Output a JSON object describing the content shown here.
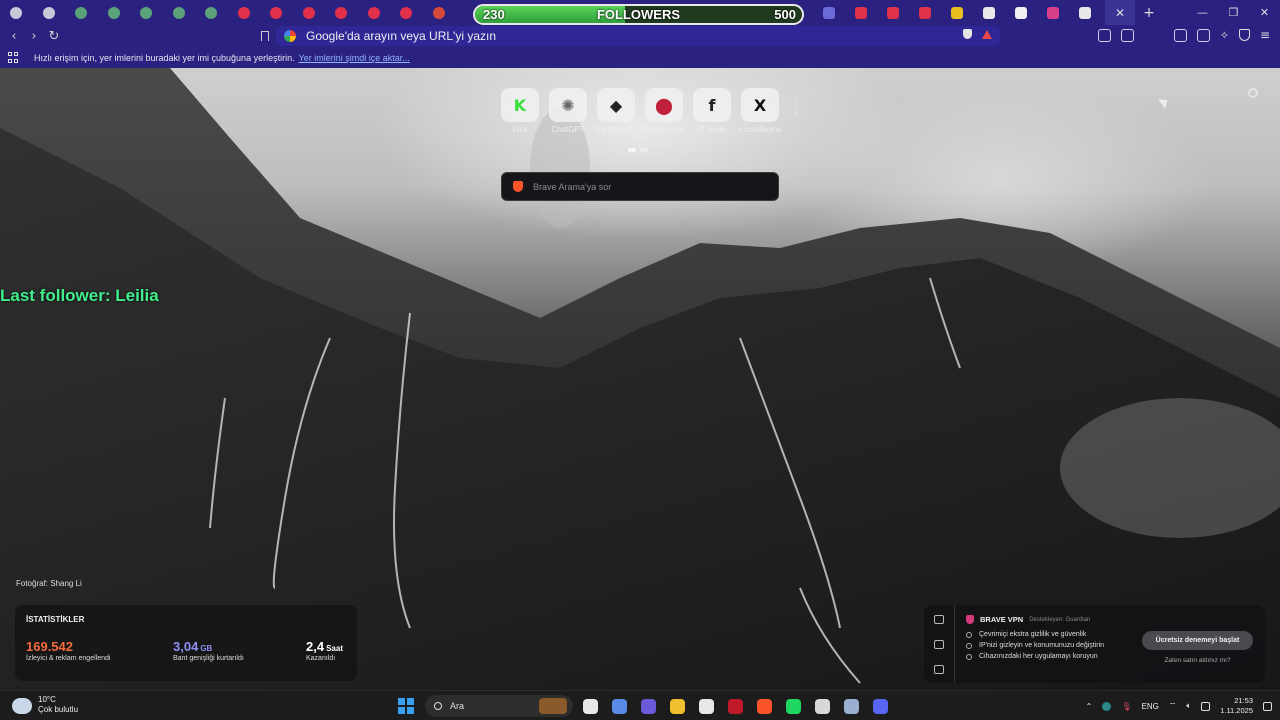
{
  "tabs": {
    "favicons": [
      {
        "name": "obs-icon",
        "color": "#c8c8d8"
      },
      {
        "name": "chat-icon",
        "color": "#c8c8d8"
      },
      {
        "name": "tab-app-icon",
        "color": "#5aa37a"
      },
      {
        "name": "tab-app-icon",
        "color": "#5aa37a"
      },
      {
        "name": "tab-app-icon",
        "color": "#5aa37a"
      },
      {
        "name": "tab-app-icon",
        "color": "#5aa37a"
      },
      {
        "name": "tab-app-icon",
        "color": "#5aa37a"
      },
      {
        "name": "youtube-icon",
        "color": "#e0304a"
      },
      {
        "name": "youtube-icon",
        "color": "#e0304a"
      },
      {
        "name": "youtube-icon",
        "color": "#e0304a"
      },
      {
        "name": "youtube-icon",
        "color": "#e0304a"
      },
      {
        "name": "youtube-icon",
        "color": "#e0304a"
      },
      {
        "name": "youtube-icon",
        "color": "#e0304a"
      },
      {
        "name": "gmail-icon",
        "color": "#d84a3a"
      }
    ],
    "right_favicons": [
      {
        "name": "site-icon",
        "color": "#6a6ad8"
      },
      {
        "name": "youtube-icon",
        "color": "#e0304a"
      },
      {
        "name": "youtube-icon",
        "color": "#e0304a"
      },
      {
        "name": "youtube-icon",
        "color": "#e0304a"
      },
      {
        "name": "notes-icon",
        "color": "#e8c020"
      },
      {
        "name": "apps-icon",
        "color": "#e8e8e8"
      },
      {
        "name": "site-icon",
        "color": "#f0f0f0"
      },
      {
        "name": "instagram-icon",
        "color": "#d8408a"
      },
      {
        "name": "chatgpt-icon",
        "color": "#e8e8e8"
      }
    ]
  },
  "followers_goal": {
    "current": "230",
    "label": "FOLLOWERS",
    "goal": "500",
    "progress": 0.46
  },
  "omnibox": {
    "placeholder": "Google'da arayın veya URL'yi yazın"
  },
  "bookmarks": {
    "hint": "Hızlı erişim için, yer imlerini buradaki yer imi çubuğuna yerleştirin.",
    "import_link": "Yer imlerini şimdi içe aktar..."
  },
  "top_sites": [
    {
      "name": "Kick",
      "icon": "kick-icon",
      "glyph": "K",
      "color": "#3ae03a"
    },
    {
      "name": "ChatGPT",
      "icon": "chatgpt-icon",
      "glyph": "✺",
      "color": "#6a6a6a"
    },
    {
      "name": "The Best C...",
      "icon": "discord-icon",
      "glyph": "◆",
      "color": "#222"
    },
    {
      "name": "GeoGuessr",
      "icon": "map-pin-icon",
      "glyph": "⬤",
      "color": "#c0203a"
    },
    {
      "name": "f2 Node",
      "icon": "f-icon",
      "glyph": "f",
      "color": "#222"
    },
    {
      "name": "x.com/home",
      "icon": "x-icon",
      "glyph": "X",
      "color": "#111"
    }
  ],
  "search": {
    "placeholder": "Brave Arama'ya sor"
  },
  "overlay": {
    "last_follower": "Last follower: Leilia"
  },
  "photo_credit": "Fotoğraf: Shang Li",
  "stats": {
    "title": "İSTATİSTİKLER",
    "items": [
      {
        "value": "169.542",
        "unit": "",
        "desc": "İzleyici & reklam engellendi",
        "color": "#f26b3a"
      },
      {
        "value": "3,04",
        "unit": "GB",
        "desc": "Bant genişliği kurtarıldı",
        "color": "#8f8ff5"
      },
      {
        "value": "2,4",
        "unit": "Saat",
        "desc": "Kazanıldı",
        "color": "#ffffff"
      }
    ]
  },
  "vpn": {
    "title": "BRAVE VPN",
    "by": "Destekleyen: Guardian",
    "features": [
      "Çevrimiçi ekstra gizlilik ve güvenlik",
      "IP'nizi gizleyin ve konumunuzu değiştirin",
      "Cihazınızdaki her uygulamayı koruyun"
    ],
    "cta": "Ücretsiz denemeyi başlat",
    "already": "Zaten satın aldınız mı?"
  },
  "taskbar": {
    "weather_temp": "10°C",
    "weather_desc": "Çok bulutlu",
    "search_label": "Ara",
    "apps": [
      {
        "name": "file-explorer-icon",
        "color": "#e8e8e8"
      },
      {
        "name": "copilot-icon",
        "color": "#5a8ae8"
      },
      {
        "name": "teams-icon",
        "color": "#6a5ad8"
      },
      {
        "name": "folder-icon",
        "color": "#f0c030"
      },
      {
        "name": "store-icon",
        "color": "#e8e8e8"
      },
      {
        "name": "app-icon",
        "color": "#c01a2a"
      },
      {
        "name": "brave-icon",
        "color": "#fb542b"
      },
      {
        "name": "spotify-icon",
        "color": "#1ed760"
      },
      {
        "name": "obs-icon",
        "color": "#d8d8d8"
      },
      {
        "name": "steam-icon",
        "color": "#9ab0d0"
      },
      {
        "name": "discord-icon",
        "color": "#5865f2"
      }
    ],
    "lang": "ENG",
    "time": "21:53",
    "date": "1.11.2025"
  }
}
